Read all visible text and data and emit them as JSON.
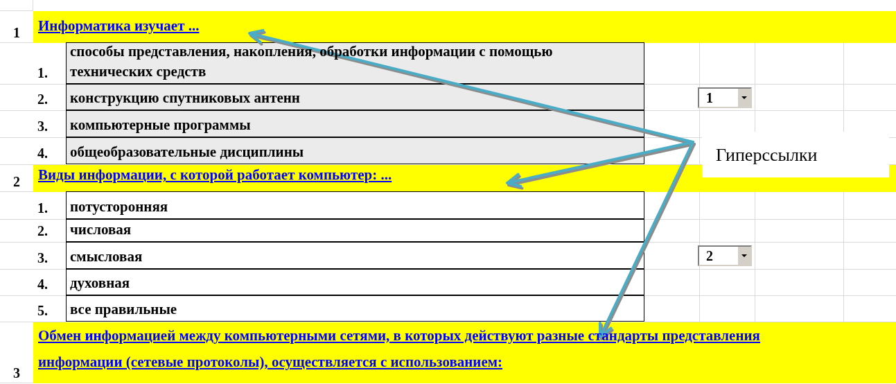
{
  "questions": [
    {
      "number": "1",
      "text": "Информатика изучает ...",
      "shaded": true,
      "options": [
        {
          "number": "1.",
          "text": "способы представления, накопления, обработки информации с помощью технических  средств"
        },
        {
          "number": "2.",
          "text": "конструкцию спутниковых антенн",
          "dropdown": {
            "value": "1"
          }
        },
        {
          "number": "3.",
          "text": "компьютерные программы"
        },
        {
          "number": "4.",
          "text": "общеобразовательные дисциплины"
        }
      ]
    },
    {
      "number": "2",
      "text": "Виды информации, с которой работает компьютер: ...",
      "shaded": false,
      "options": [
        {
          "number": "1.",
          "text": "потусторонняя"
        },
        {
          "number": "2.",
          "text": "числовая"
        },
        {
          "number": "3.",
          "text": "смысловая",
          "dropdown": {
            "value": "2"
          }
        },
        {
          "number": "4.",
          "text": "духовная"
        },
        {
          "number": "5.",
          "text": "все правильные"
        }
      ]
    },
    {
      "number": "3",
      "text": "Обмен информацией между компьютерными сетями, в которых действуют разные стандарты представления информации  (сетевые протоколы), осуществляется с использованием:"
    }
  ],
  "callout": {
    "text": "Гиперссылки"
  }
}
